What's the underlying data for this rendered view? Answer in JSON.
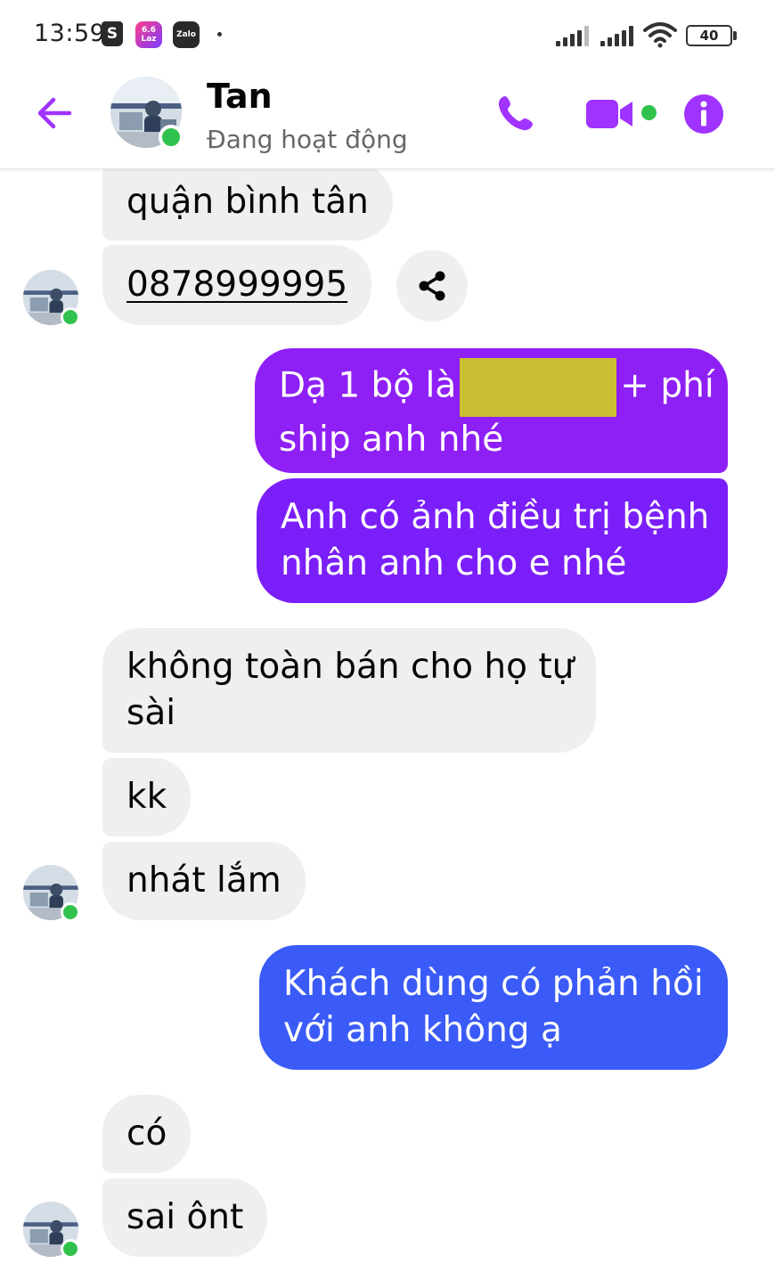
{
  "status_bar": {
    "time": "13:59",
    "icons": [
      "shopee-icon",
      "lazada-icon",
      "zalo-icon"
    ],
    "shopee_letter": "S",
    "lazada_text_top": "6.6",
    "lazada_text_bottom": "Laz",
    "zalo_text": "Zalo",
    "battery": "40"
  },
  "header": {
    "name": "Tan",
    "status": "Đang hoạt động"
  },
  "colors": {
    "accent": "#a033ff",
    "online": "#31c24d",
    "incoming_bg": "#efefef",
    "outgoing_1": "#8e1ff5",
    "outgoing_2": "#7a1ff9",
    "outgoing_3": "#3a5bf7",
    "redaction": "#c9bf32"
  },
  "messages": [
    {
      "dir": "in",
      "text": "quận bình tân"
    },
    {
      "dir": "in",
      "text": "0878999995",
      "is_link": true
    },
    {
      "dir": "out",
      "lines": [
        "Dạ 1 bộ là",
        "+ phí",
        "ship anh nhé"
      ],
      "redacted": true
    },
    {
      "dir": "out",
      "lines": [
        "Anh có ảnh điều trị bệnh",
        "nhân anh cho e nhé"
      ]
    },
    {
      "dir": "in",
      "lines": [
        "không toàn bán cho họ tự",
        "sài"
      ]
    },
    {
      "dir": "in",
      "text": "kk"
    },
    {
      "dir": "in",
      "text": "nhát lắm"
    },
    {
      "dir": "out",
      "lines": [
        "Khách dùng có phản hồi",
        "với anh không ạ"
      ]
    },
    {
      "dir": "in",
      "text": "có"
    },
    {
      "dir": "in",
      "text": "sai ônt"
    }
  ]
}
